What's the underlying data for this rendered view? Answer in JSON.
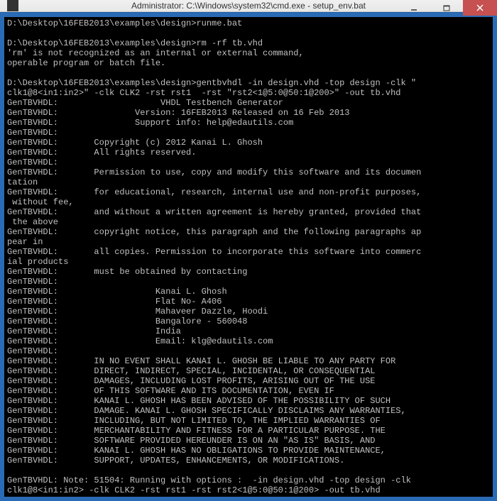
{
  "window": {
    "title": "Administrator: C:\\Windows\\system32\\cmd.exe - setup_env.bat"
  },
  "console": {
    "lines": [
      "D:\\Desktop\\16FEB2013\\examples\\design>runme.bat",
      "",
      "D:\\Desktop\\16FEB2013\\examples\\design>rm -rf tb.vhd",
      "'rm' is not recognized as an internal or external command,",
      "operable program or batch file.",
      "",
      "D:\\Desktop\\16FEB2013\\examples\\design>gentbvhdl -in design.vhd -top design -clk \"",
      "clk1@8<in1:in2>\" -clk CLK2 -rst rst1  -rst \"rst2<1@5:0@50:1@200>\" -out tb.vhd",
      "GenTBVHDL:                    VHDL Testbench Generator",
      "GenTBVHDL:               Version: 16FEB2013 Released on 16 Feb 2013",
      "GenTBVHDL:               Support info: help@edautils.com",
      "GenTBVHDL:",
      "GenTBVHDL:       Copyright (c) 2012 Kanai L. Ghosh",
      "GenTBVHDL:       All rights reserved.",
      "GenTBVHDL:",
      "GenTBVHDL:       Permission to use, copy and modify this software and its documen",
      "tation",
      "GenTBVHDL:       for educational, research, internal use and non-profit purposes,",
      " without fee,",
      "GenTBVHDL:       and without a written agreement is hereby granted, provided that",
      " the above",
      "GenTBVHDL:       copyright notice, this paragraph and the following paragraphs ap",
      "pear in",
      "GenTBVHDL:       all copies. Permission to incorporate this software into commerc",
      "ial products",
      "GenTBVHDL:       must be obtained by contacting",
      "GenTBVHDL:",
      "GenTBVHDL:                   Kanai L. Ghosh",
      "GenTBVHDL:                   Flat No- A406",
      "GenTBVHDL:                   Mahaveer Dazzle, Hoodi",
      "GenTBVHDL:                   Bangalore - 560048",
      "GenTBVHDL:                   India",
      "GenTBVHDL:                   Email: klg@edautils.com",
      "GenTBVHDL:",
      "GenTBVHDL:       IN NO EVENT SHALL KANAI L. GHOSH BE LIABLE TO ANY PARTY FOR",
      "GenTBVHDL:       DIRECT, INDIRECT, SPECIAL, INCIDENTAL, OR CONSEQUENTIAL",
      "GenTBVHDL:       DAMAGES, INCLUDING LOST PROFITS, ARISING OUT OF THE USE",
      "GenTBVHDL:       OF THIS SOFTWARE AND ITS DOCUMENTATION, EVEN IF",
      "GenTBVHDL:       KANAI L. GHOSH HAS BEEN ADVISED OF THE POSSIBILITY OF SUCH",
      "GenTBVHDL:       DAMAGE. KANAI L. GHOSH SPECIFICALLY DISCLAIMS ANY WARRANTIES,",
      "GenTBVHDL:       INCLUDING, BUT NOT LIMITED TO, THE IMPLIED WARRANTIES OF",
      "GenTBVHDL:       MERCHANTABILITY AND FITNESS FOR A PARTICULAR PURPOSE. THE",
      "GenTBVHDL:       SOFTWARE PROVIDED HEREUNDER IS ON AN \"AS IS\" BASIS, AND",
      "GenTBVHDL:       KANAI L. GHOSH HAS NO OBLIGATIONS TO PROVIDE MAINTENANCE,",
      "GenTBVHDL:       SUPPORT, UPDATES, ENHANCEMENTS, OR MODIFICATIONS.",
      "",
      "GenTBVHDL: Note: 51504: Running with options :  -in design.vhd -top design -clk",
      "clk1@8<in1:in2> -clk CLK2 -rst rst1 -rst rst2<1@5:0@50:1@200> -out tb.vhd"
    ]
  }
}
